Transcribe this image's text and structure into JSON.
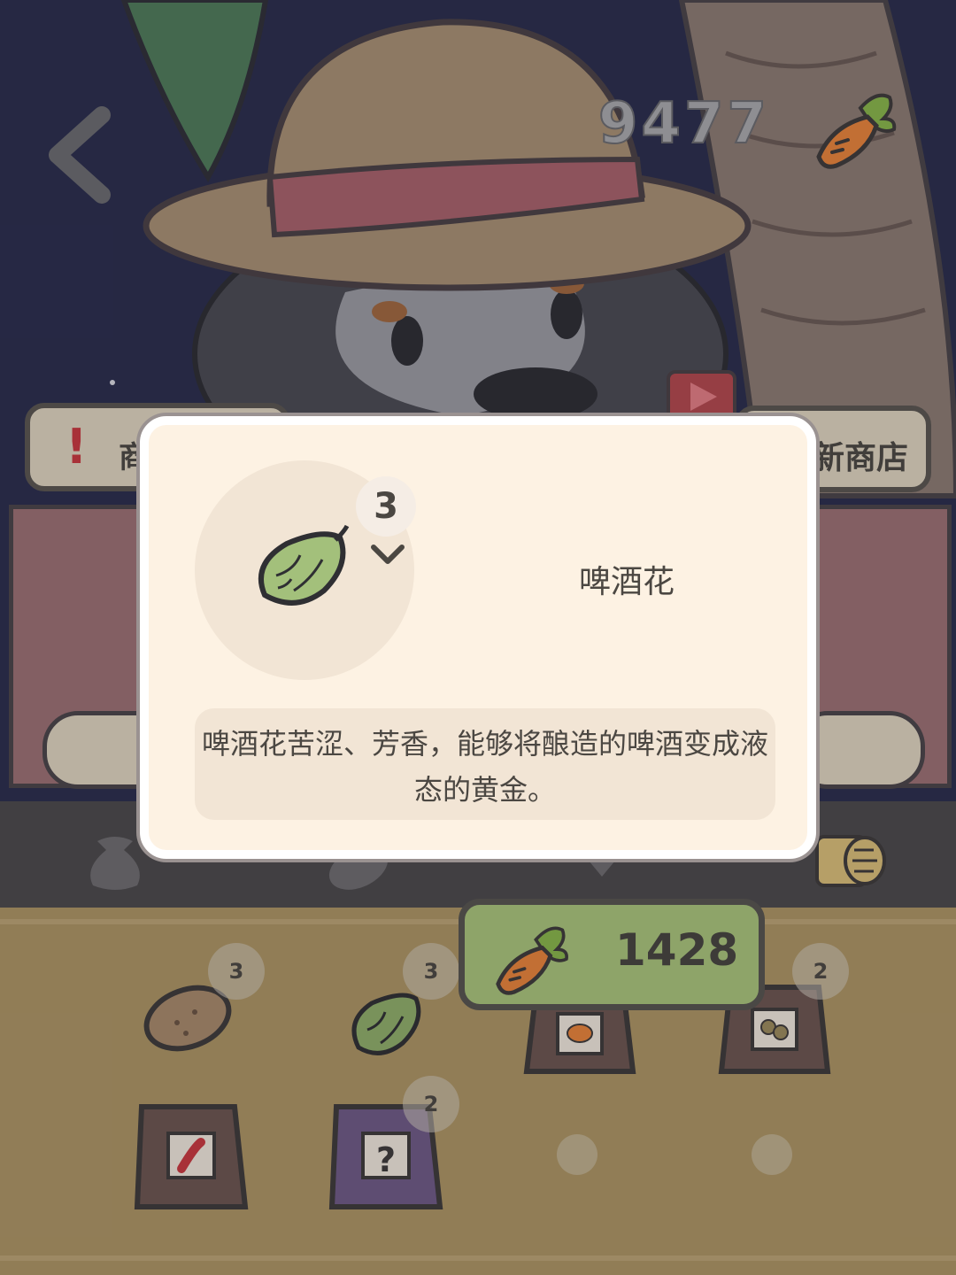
{
  "hud": {
    "currency_total": "9477"
  },
  "stall": {
    "left_label": "商",
    "right_label": "新商店"
  },
  "price_button": {
    "value": "1428"
  },
  "inventory": {
    "items": [
      {
        "name": "potato",
        "count": "3"
      },
      {
        "name": "hops",
        "count": "3"
      },
      {
        "name": "pumpkin-seed-bag",
        "count": ""
      },
      {
        "name": "bean-seed-bag",
        "count": "2"
      },
      {
        "name": "pepper-seed-bag",
        "count": ""
      },
      {
        "name": "mystery-seed-bag",
        "count": "2"
      }
    ]
  },
  "modal": {
    "quantity": "3",
    "item_name": "啤酒花",
    "description": "啤酒花苦涩、芳香，能够将酿造的啤酒变成液态的黄金。"
  },
  "colors": {
    "accent_green": "#a9c47b",
    "modal_bg": "#fdf2e3",
    "alert_red": "#c9383f"
  }
}
